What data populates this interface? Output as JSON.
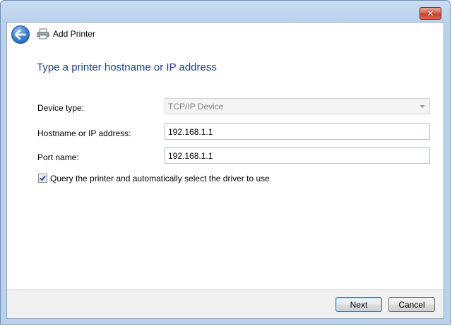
{
  "window": {
    "title": "Add Printer",
    "close_glyph": "✕"
  },
  "page": {
    "heading": "Type a printer hostname or IP address"
  },
  "form": {
    "device_type_label": "Device type:",
    "device_type_value": "TCP/IP Device",
    "hostname_label": "Hostname or IP address:",
    "hostname_value": "192.168.1.1",
    "port_label": "Port name:",
    "port_value": "192.168.1.1",
    "query_checkbox_label": "Query the printer and automatically select the driver to use",
    "query_checked": true
  },
  "buttons": {
    "next": "Next",
    "cancel": "Cancel"
  },
  "icons": {
    "back": "back-arrow-icon",
    "printer": "printer-icon",
    "close": "close-icon",
    "dropdown": "chevron-down-icon",
    "check": "checkmark-icon"
  },
  "colors": {
    "heading": "#1e3f8c",
    "frame": "#b9d1ea",
    "close_button": "#c8422a",
    "back_button": "#3d7fd0"
  }
}
